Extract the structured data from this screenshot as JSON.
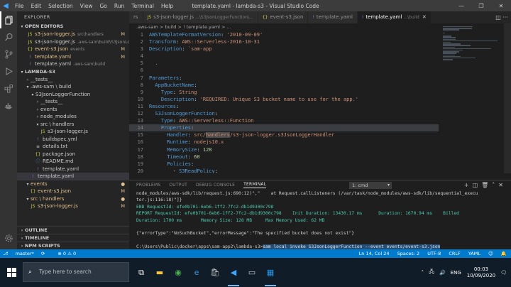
{
  "window": {
    "title": "template.yaml - lambda-s3 - Visual Studio Code",
    "menu": [
      "File",
      "Edit",
      "Selection",
      "View",
      "Go",
      "Run",
      "Terminal",
      "Help"
    ]
  },
  "sidebar": {
    "title": "EXPLORER",
    "open_editors": {
      "label": "OPEN EDITORS",
      "items": [
        {
          "name": "s3-json-logger.js",
          "path": "src\\handlers",
          "badge": "M",
          "icon": "js"
        },
        {
          "name": "s3-json-logger.js",
          "path": ".aws-sam\\build\\S3JsonLo...",
          "badge": "",
          "icon": "js"
        },
        {
          "name": "event-s3.json",
          "path": "events",
          "badge": "M",
          "icon": "json"
        },
        {
          "name": "template.yaml",
          "path": "",
          "badge": "M",
          "icon": "yaml"
        },
        {
          "name": "template.yaml",
          "path": ".aws-sam\\build",
          "badge": "",
          "icon": "yaml"
        }
      ]
    },
    "project": {
      "label": "LAMBDA-S3",
      "items": [
        {
          "label": "__tests__",
          "kind": "folder",
          "depth": 1,
          "open": false
        },
        {
          "label": ".aws-sam \\ build",
          "kind": "folder",
          "depth": 1,
          "open": true
        },
        {
          "label": "S3JsonLoggerFunction",
          "kind": "folder",
          "depth": 2,
          "open": true
        },
        {
          "label": "__tests__",
          "kind": "folder",
          "depth": 3,
          "open": false
        },
        {
          "label": "events",
          "kind": "folder",
          "depth": 3,
          "open": false
        },
        {
          "label": "node_modules",
          "kind": "folder",
          "depth": 3,
          "open": false
        },
        {
          "label": "src \\ handlers",
          "kind": "folder",
          "depth": 3,
          "open": true
        },
        {
          "label": "s3-json-logger.js",
          "kind": "js",
          "depth": 4
        },
        {
          "label": "buildspec.yml",
          "kind": "yaml",
          "depth": 3
        },
        {
          "label": "details.txt",
          "kind": "txt",
          "depth": 3
        },
        {
          "label": "package.json",
          "kind": "json",
          "depth": 3
        },
        {
          "label": "README.md",
          "kind": "md",
          "depth": 3
        },
        {
          "label": "template.yaml",
          "kind": "yaml",
          "depth": 3
        },
        {
          "label": "template.yaml",
          "kind": "yaml",
          "depth": 2,
          "selected": true
        },
        {
          "label": "events",
          "kind": "folder",
          "depth": 1,
          "open": true,
          "badge": "●"
        },
        {
          "label": "event-s3.json",
          "kind": "json",
          "depth": 2,
          "badge": "M"
        },
        {
          "label": "src \\ handlers",
          "kind": "folder",
          "depth": 1,
          "open": true,
          "badge": "●"
        },
        {
          "label": "s3-json-logger.js",
          "kind": "js",
          "depth": 2,
          "badge": "M"
        }
      ]
    },
    "outline_label": "OUTLINE",
    "timeline_label": "TIMELINE",
    "npm_label": "NPM SCRIPTS"
  },
  "tabs": [
    {
      "label": "rs",
      "sub": "",
      "icon": "",
      "active": false
    },
    {
      "label": "s3-json-logger.js",
      "sub": "...\\S3JsonLoggerFunction\\...",
      "icon": "JS",
      "active": false
    },
    {
      "label": "event-s3.json",
      "sub": "",
      "icon": "{}",
      "active": false
    },
    {
      "label": "template.yaml",
      "sub": "",
      "icon": "!",
      "active": false
    },
    {
      "label": "template.yaml",
      "sub": "...\\build",
      "icon": "!",
      "active": true
    }
  ],
  "breadcrumb": ".aws-sam > build > ! template.yaml > ...",
  "editor": {
    "lines": [
      {
        "n": "1",
        "parts": [
          [
            "k",
            "AWSTemplateFormatVersion"
          ],
          [
            "t",
            ": "
          ],
          [
            "s",
            "'2010-09-09'"
          ]
        ]
      },
      {
        "n": "2",
        "parts": [
          [
            "k",
            "Transform"
          ],
          [
            "t",
            ": "
          ],
          [
            "s",
            "AWS::Serverless-2016-10-31"
          ]
        ]
      },
      {
        "n": "3",
        "parts": [
          [
            "k",
            "Description"
          ],
          [
            "t",
            ": "
          ],
          [
            "s",
            "`sam-app"
          ]
        ]
      },
      {
        "n": "4",
        "parts": []
      },
      {
        "n": "5",
        "parts": [
          [
            "s",
            "  ."
          ]
        ]
      },
      {
        "n": "6",
        "parts": []
      },
      {
        "n": "7",
        "parts": [
          [
            "k",
            "Parameters"
          ],
          [
            "t",
            ":"
          ]
        ]
      },
      {
        "n": "8",
        "parts": [
          [
            "k",
            "  AppBucketName"
          ],
          [
            "t",
            ":"
          ]
        ]
      },
      {
        "n": "9",
        "parts": [
          [
            "k",
            "    Type"
          ],
          [
            "t",
            ": "
          ],
          [
            "s",
            "String"
          ]
        ]
      },
      {
        "n": "10",
        "parts": [
          [
            "k",
            "    Description"
          ],
          [
            "t",
            ": "
          ],
          [
            "s",
            "'REQUIRED: Unique S3 bucket name to use for the app.'"
          ]
        ]
      },
      {
        "n": "11",
        "parts": [
          [
            "k",
            "Resources"
          ],
          [
            "t",
            ":"
          ]
        ]
      },
      {
        "n": "12",
        "parts": [
          [
            "k",
            "  S3JsonLoggerFunction"
          ],
          [
            "t",
            ":"
          ]
        ]
      },
      {
        "n": "13",
        "parts": [
          [
            "k",
            "    Type"
          ],
          [
            "t",
            ": "
          ],
          [
            "s",
            "AWS::Serverless::Function"
          ]
        ]
      },
      {
        "n": "14",
        "parts": [
          [
            "k",
            "    Properties"
          ],
          [
            "t",
            ":"
          ]
        ],
        "highlight": true
      },
      {
        "n": "15",
        "parts": [
          [
            "k",
            "      Handler"
          ],
          [
            "t",
            ": "
          ],
          [
            "s",
            "src/"
          ],
          [
            "h",
            "handlers"
          ],
          [
            "s",
            "/s3-json-logger.s3JsonLoggerHandler"
          ]
        ]
      },
      {
        "n": "16",
        "parts": [
          [
            "k",
            "      Runtime"
          ],
          [
            "t",
            ": "
          ],
          [
            "s",
            "nodejs10.x"
          ]
        ]
      },
      {
        "n": "17",
        "parts": [
          [
            "k",
            "      MemorySize"
          ],
          [
            "t",
            ": "
          ],
          [
            "n",
            "128"
          ]
        ]
      },
      {
        "n": "18",
        "parts": [
          [
            "k",
            "      Timeout"
          ],
          [
            "t",
            ": "
          ],
          [
            "n",
            "60"
          ]
        ]
      },
      {
        "n": "19",
        "parts": [
          [
            "k",
            "      Policies"
          ],
          [
            "t",
            ":"
          ]
        ]
      },
      {
        "n": "20",
        "parts": [
          [
            "t",
            "        - "
          ],
          [
            "k",
            "S3ReadPolicy"
          ],
          [
            "t",
            ":"
          ]
        ]
      },
      {
        "n": "21",
        "parts": [
          [
            "k",
            "            BucketName"
          ],
          [
            "t",
            ": "
          ],
          [
            "t",
            "!Ref AppBucketName"
          ]
        ]
      },
      {
        "n": "22",
        "parts": [
          [
            "k",
            "      Events"
          ],
          [
            "t",
            ":"
          ]
        ]
      }
    ]
  },
  "panel": {
    "tabs": [
      "PROBLEMS",
      "OUTPUT",
      "DEBUG CONSOLE",
      "TERMINAL"
    ],
    "active_tab": "TERMINAL",
    "terminal_select": "1: cmd",
    "lines": [
      {
        "text": "node_modules/aws-sdk/lib/request.js:690:12)\",\"    at Request.callListeners (/var/task/node_modules/aws-sdk/lib/sequential_execu",
        "style": ""
      },
      {
        "text": "tor.js:116:18)\"]}",
        "style": ""
      },
      {
        "text": "END RequestId: efe0b701-6eb6-1ff2-7fc2-db1d9300c798",
        "style": "cyan"
      },
      {
        "text": "REPORT RequestId: efe0b701-6eb6-1ff2-7fc2-db1d9300c798    Init Duration: 13430.17 ms      Duration: 1670.94 ms    Billed",
        "style": "cyan"
      },
      {
        "text": "Duration: 1700 ms       Memory Size: 128 MB     Max Memory Used: 62 MB",
        "style": "cyan"
      },
      {
        "text": "",
        "style": ""
      },
      {
        "text": "{\"errorType\":\"NoSuchBucket\",\"errorMessage\":\"The specified bucket does not exist\"}",
        "style": ""
      },
      {
        "text": "",
        "style": ""
      }
    ],
    "prompt": "C:\\Users\\Public\\docker\\apps\\sam-app2\\lambda-s3>",
    "command": "sam local invoke S3JsonLoggerFunction --event events/event-s3.json"
  },
  "statusbar": {
    "branch": "master*",
    "sync": "⟳",
    "problems": "⊗ 0 ⚠ 0",
    "position": "Ln 14, Col 24",
    "spaces": "Spaces: 2",
    "encoding": "UTF-8",
    "eol": "CRLF",
    "language": "YAML"
  },
  "taskbar": {
    "search_placeholder": "Type here to search",
    "language": "ENG",
    "time": "00:03",
    "date": "10/09/2020"
  },
  "colors": {
    "accent": "#007acc",
    "keyword": "#569cd6",
    "string": "#ce9178",
    "number": "#b5cea8"
  }
}
